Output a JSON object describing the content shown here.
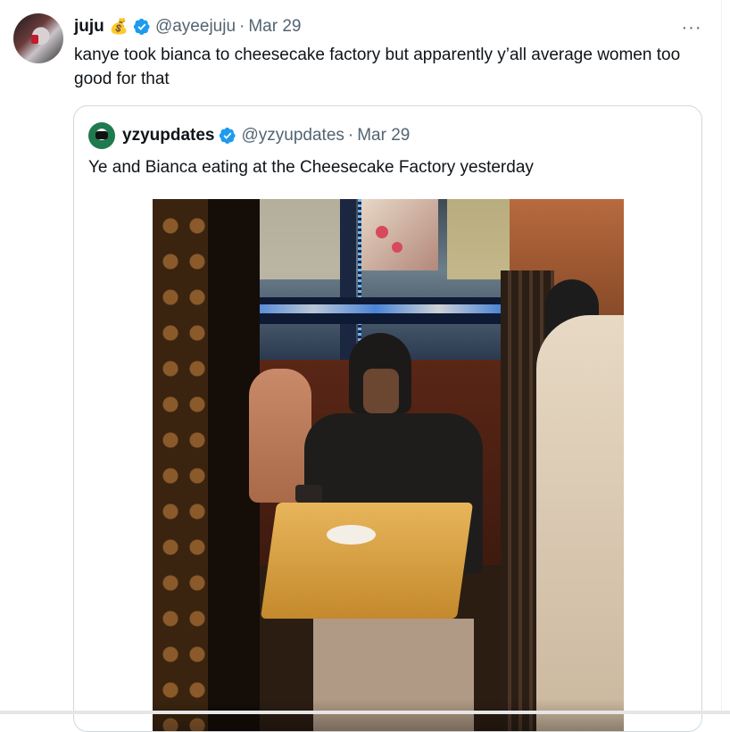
{
  "author": {
    "name": "juju",
    "emoji": "💰",
    "handle": "@ayeejuju",
    "separator": "·",
    "date": "Mar 29",
    "more_label": "···"
  },
  "tweet": {
    "text": "kanye took bianca to cheesecake factory but apparently y’all average women too good for that"
  },
  "quoted": {
    "name": "yzyupdates",
    "handle": "@yzyupdates",
    "separator": "·",
    "date": "Mar 29",
    "text": "Ye and Bianca eating at the Cheesecake Factory yesterday"
  },
  "colors": {
    "verified_badge": "#1d9bf0",
    "secondary_text": "#536471",
    "quote_border": "#cfd9de"
  },
  "icons": {
    "more": "more-horizontal-icon",
    "verified": "verified-badge-icon"
  }
}
